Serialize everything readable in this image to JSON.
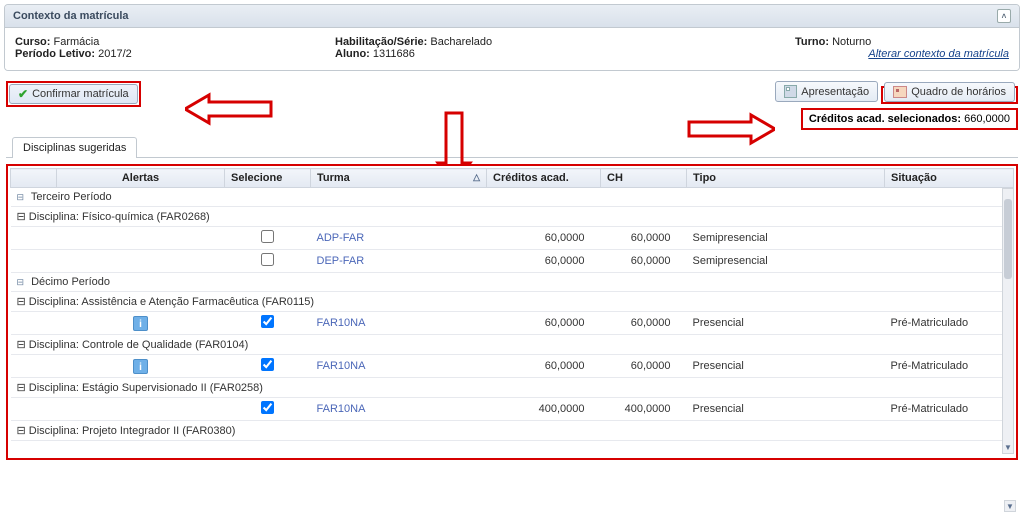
{
  "panelTitle": "Contexto da matrícula",
  "info": {
    "cursoLabel": "Curso:",
    "curso": "Farmácia",
    "periodoLabel": "Período Letivo:",
    "periodo": "2017/2",
    "habLabel": "Habilitação/Série:",
    "hab": "Bacharelado",
    "alunoLabel": "Aluno:",
    "aluno": "1311686",
    "turnoLabel": "Turno:",
    "turno": "Noturno",
    "alterar": "Alterar contexto da matrícula"
  },
  "buttons": {
    "confirm": "Confirmar matrícula",
    "present": "Apresentação",
    "schedule": "Quadro de horários"
  },
  "credits": {
    "label": "Créditos acad. selecionados:",
    "value": "660,0000"
  },
  "tabs": {
    "active": "Disciplinas sugeridas"
  },
  "headers": {
    "alertas": "Alertas",
    "selecione": "Selecione",
    "turma": "Turma",
    "cred": "Créditos acad.",
    "ch": "CH",
    "tipo": "Tipo",
    "situacao": "Situação"
  },
  "groups": [
    {
      "name": "Terceiro Período",
      "disciplines": [
        {
          "name": "Disciplina: Físico-química (FAR0268)",
          "rows": [
            {
              "info": false,
              "checked": false,
              "turma": "ADP-FAR",
              "cred": "60,0000",
              "ch": "60,0000",
              "tipo": "Semipresencial",
              "sit": ""
            },
            {
              "info": false,
              "checked": false,
              "turma": "DEP-FAR",
              "cred": "60,0000",
              "ch": "60,0000",
              "tipo": "Semipresencial",
              "sit": ""
            }
          ]
        }
      ]
    },
    {
      "name": "Décimo Período",
      "disciplines": [
        {
          "name": "Disciplina: Assistência e Atenção Farmacêutica (FAR0115)",
          "rows": [
            {
              "info": true,
              "checked": true,
              "turma": "FAR10NA",
              "cred": "60,0000",
              "ch": "60,0000",
              "tipo": "Presencial",
              "sit": "Pré-Matriculado"
            }
          ]
        },
        {
          "name": "Disciplina: Controle de Qualidade (FAR0104)",
          "rows": [
            {
              "info": true,
              "checked": true,
              "turma": "FAR10NA",
              "cred": "60,0000",
              "ch": "60,0000",
              "tipo": "Presencial",
              "sit": "Pré-Matriculado"
            }
          ]
        },
        {
          "name": "Disciplina: Estágio Supervisionado II (FAR0258)",
          "rows": [
            {
              "info": false,
              "checked": true,
              "turma": "FAR10NA",
              "cred": "400,0000",
              "ch": "400,0000",
              "tipo": "Presencial",
              "sit": "Pré-Matriculado"
            }
          ]
        },
        {
          "name": "Disciplina: Projeto Integrador II (FAR0380)",
          "rows": []
        }
      ]
    }
  ]
}
